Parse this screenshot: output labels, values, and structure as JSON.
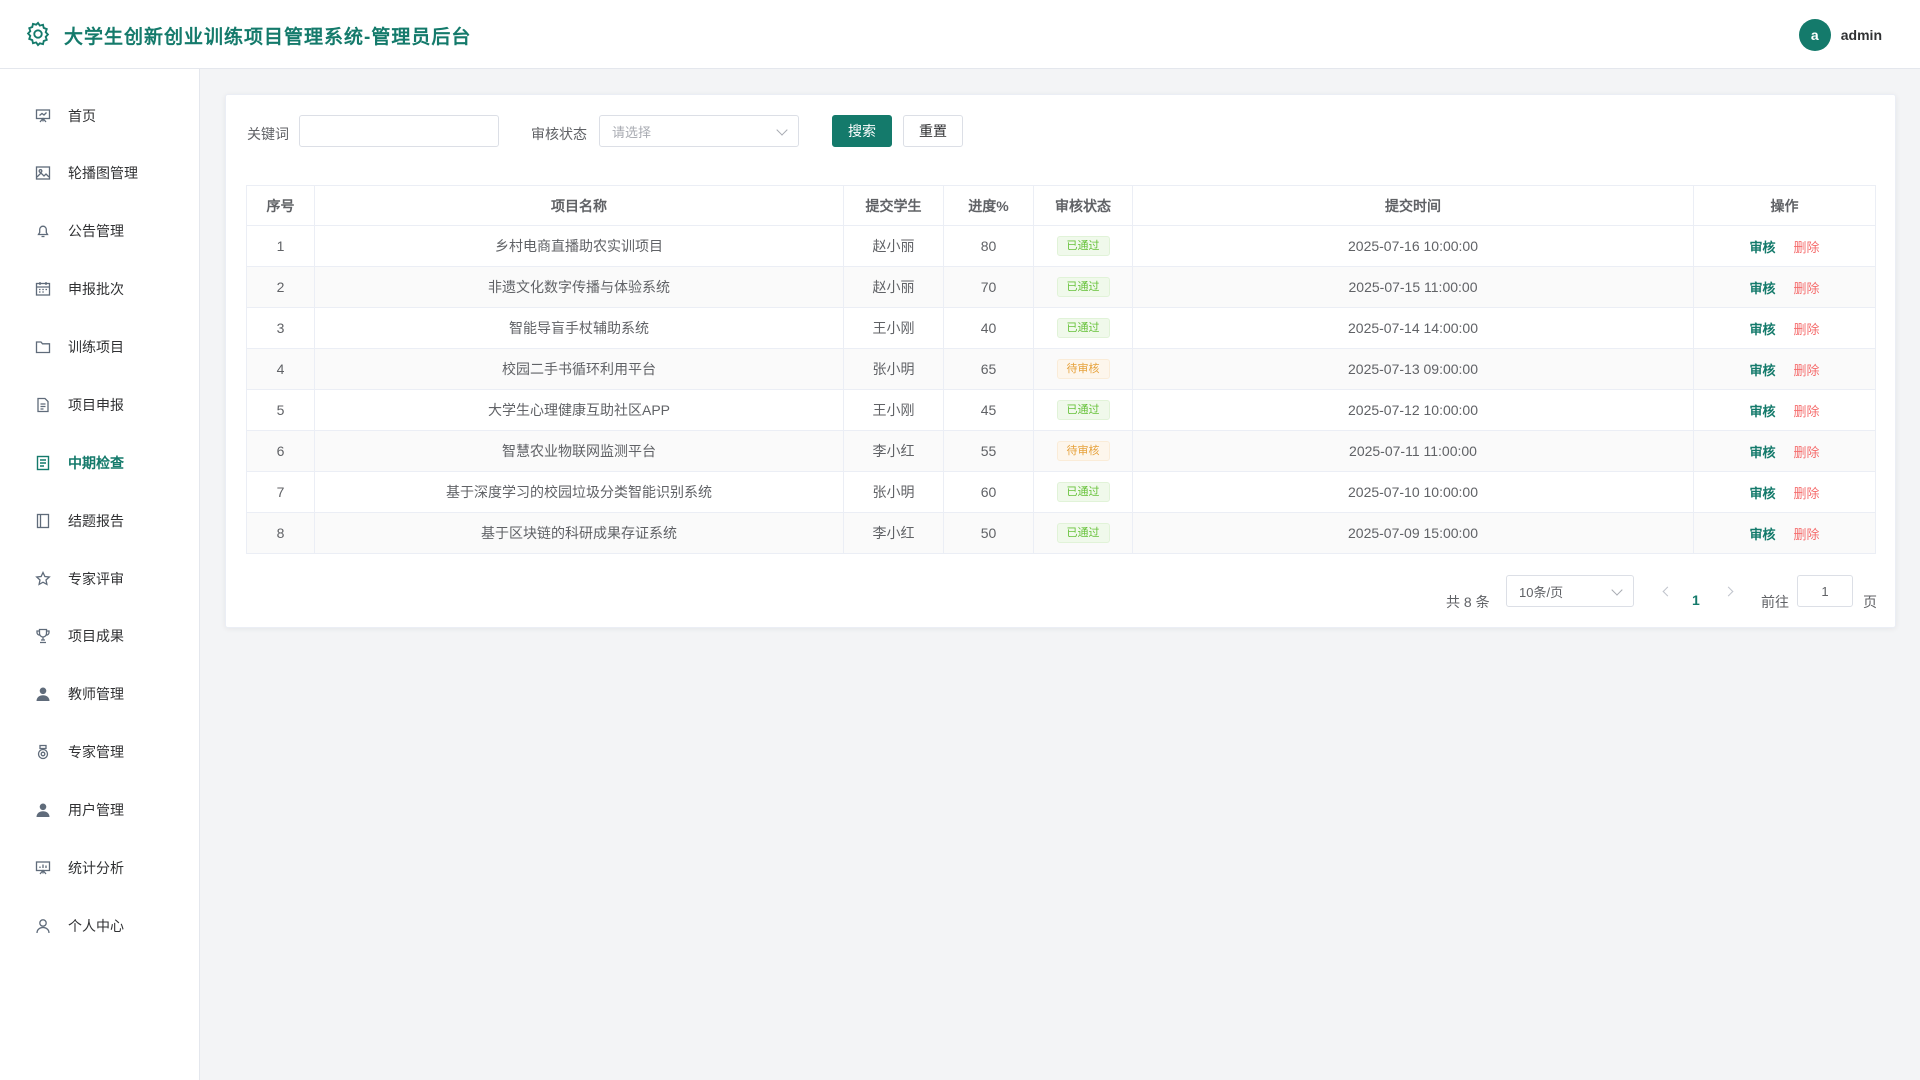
{
  "header": {
    "title": "大学生创新创业训练项目管理系统-管理员后台",
    "avatar_letter": "a",
    "username": "admin",
    "accent": "#147a6b"
  },
  "sidebar": {
    "items": [
      {
        "label": "首页",
        "icon": "presentation-icon"
      },
      {
        "label": "轮播图管理",
        "icon": "image-icon"
      },
      {
        "label": "公告管理",
        "icon": "bell-icon"
      },
      {
        "label": "申报批次",
        "icon": "calendar-icon"
      },
      {
        "label": "训练项目",
        "icon": "folder-icon"
      },
      {
        "label": "项目申报",
        "icon": "document-icon"
      },
      {
        "label": "中期检查",
        "icon": "checklist-icon",
        "active": true
      },
      {
        "label": "结题报告",
        "icon": "notebook-icon"
      },
      {
        "label": "专家评审",
        "icon": "star-icon"
      },
      {
        "label": "项目成果",
        "icon": "trophy-icon"
      },
      {
        "label": "教师管理",
        "icon": "user-filled-icon"
      },
      {
        "label": "专家管理",
        "icon": "medal-icon"
      },
      {
        "label": "用户管理",
        "icon": "user-filled-icon"
      },
      {
        "label": "统计分析",
        "icon": "chart-board-icon"
      },
      {
        "label": "个人中心",
        "icon": "user-outline-icon"
      }
    ]
  },
  "filters": {
    "keyword_label": "关键词",
    "keyword_value": "",
    "status_label": "审核状态",
    "status_placeholder": "请选择",
    "search_label": "搜索",
    "reset_label": "重置"
  },
  "table": {
    "headers": [
      "序号",
      "项目名称",
      "提交学生",
      "进度%",
      "审核状态",
      "提交时间",
      "操作"
    ],
    "rows": [
      {
        "index": "1",
        "name": "乡村电商直播助农实训项目",
        "student": "赵小丽",
        "progress": "80",
        "status": "已通过",
        "time": "2025-07-16 10:00:00"
      },
      {
        "index": "2",
        "name": "非遗文化数字传播与体验系统",
        "student": "赵小丽",
        "progress": "70",
        "status": "已通过",
        "time": "2025-07-15 11:00:00"
      },
      {
        "index": "3",
        "name": "智能导盲手杖辅助系统",
        "student": "王小刚",
        "progress": "40",
        "status": "已通过",
        "time": "2025-07-14 14:00:00"
      },
      {
        "index": "4",
        "name": "校园二手书循环利用平台",
        "student": "张小明",
        "progress": "65",
        "status": "待审核",
        "time": "2025-07-13 09:00:00"
      },
      {
        "index": "5",
        "name": "大学生心理健康互助社区APP",
        "student": "王小刚",
        "progress": "45",
        "status": "已通过",
        "time": "2025-07-12 10:00:00"
      },
      {
        "index": "6",
        "name": "智慧农业物联网监测平台",
        "student": "李小红",
        "progress": "55",
        "status": "待审核",
        "time": "2025-07-11 11:00:00"
      },
      {
        "index": "7",
        "name": "基于深度学习的校园垃圾分类智能识别系统",
        "student": "张小明",
        "progress": "60",
        "status": "已通过",
        "time": "2025-07-10 10:00:00"
      },
      {
        "index": "8",
        "name": "基于区块链的科研成果存证系统",
        "student": "李小红",
        "progress": "50",
        "status": "已通过",
        "time": "2025-07-09 15:00:00"
      }
    ],
    "action_audit": "审核",
    "action_delete": "删除"
  },
  "pagination": {
    "total_text": "共 8 条",
    "page_size": "10条/页",
    "current_page": "1",
    "goto_label": "前往",
    "goto_value": "1",
    "page_unit": "页"
  }
}
